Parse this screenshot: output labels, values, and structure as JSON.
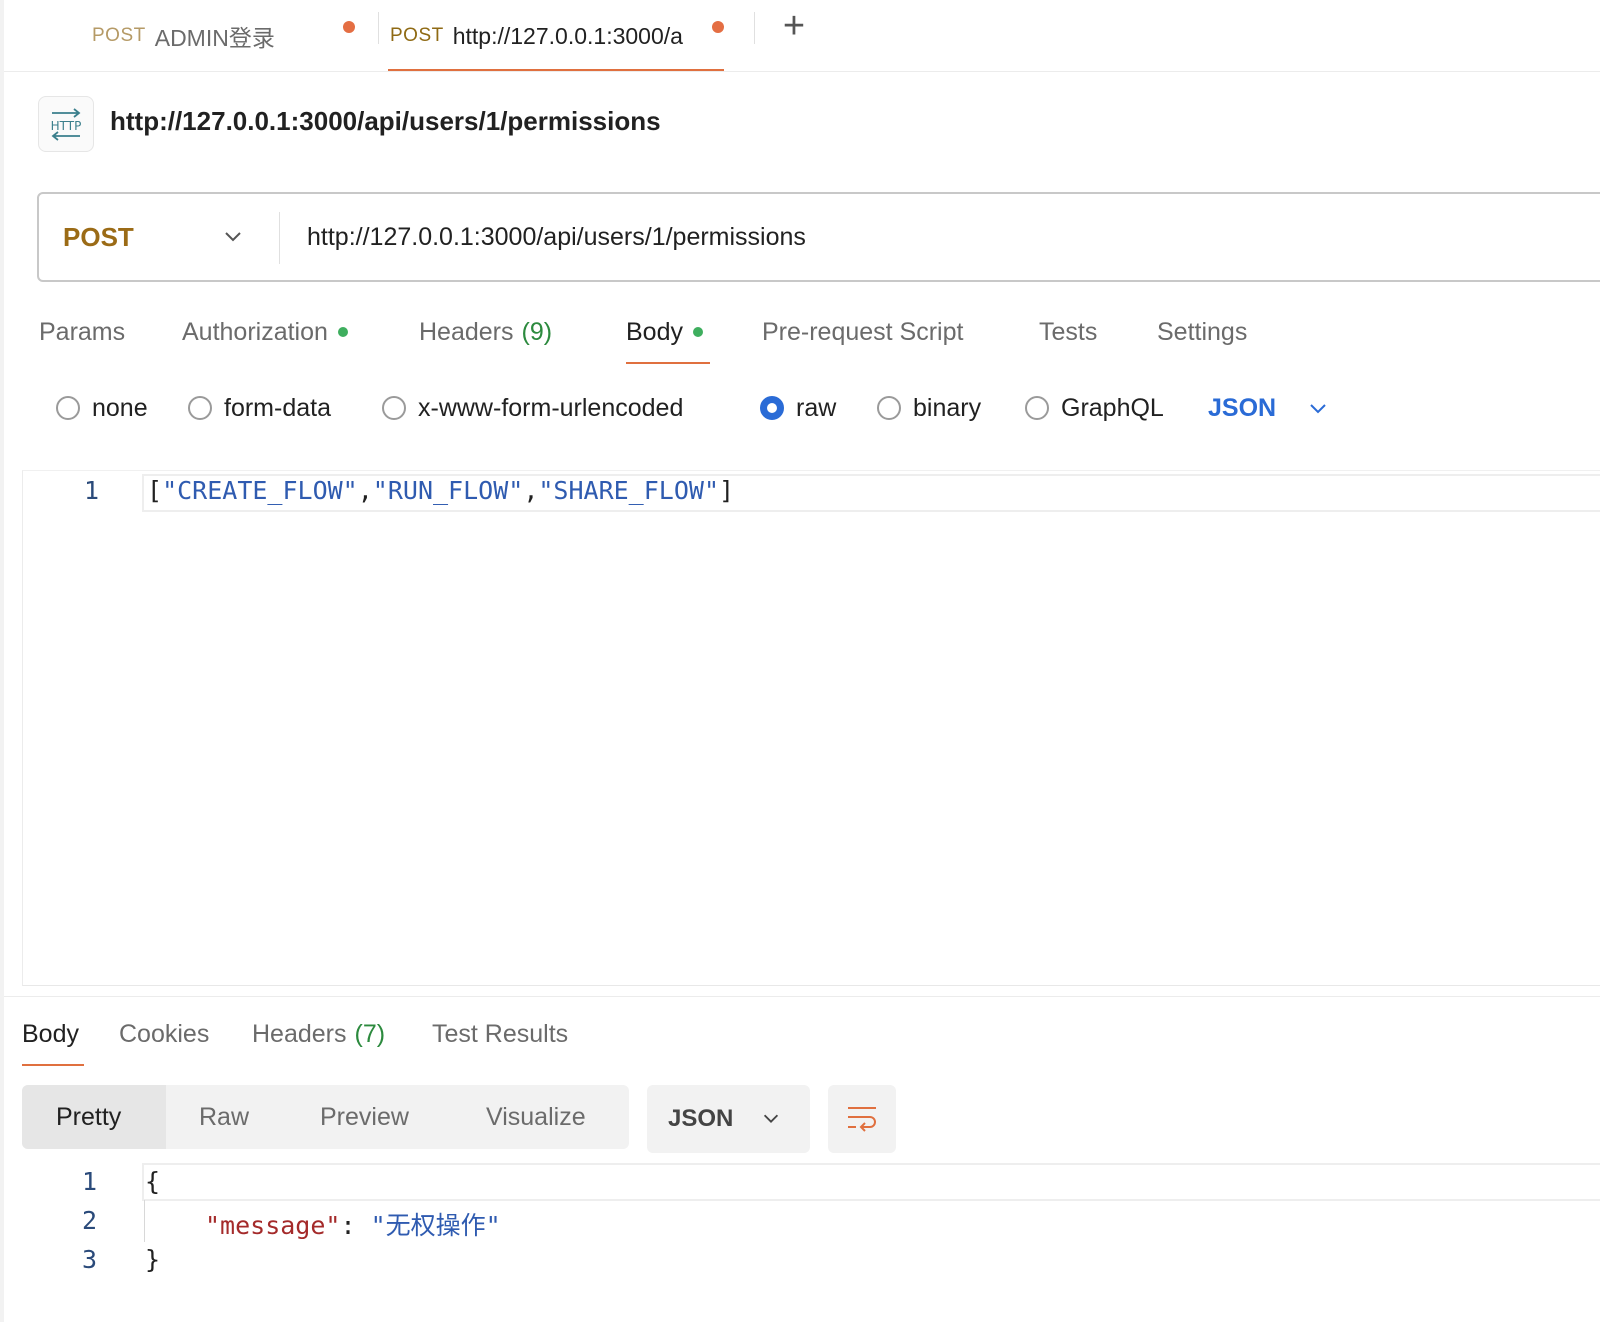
{
  "tabs": [
    {
      "method": "POST",
      "title": "ADMIN登录",
      "unsaved": true
    },
    {
      "method": "POST",
      "title": "http://127.0.0.1:3000/a",
      "unsaved": true,
      "active": true
    }
  ],
  "new_tab_label": "+",
  "request": {
    "type_badge": "HTTP",
    "title": "http://127.0.0.1:3000/api/users/1/permissions",
    "method": "POST",
    "url": "http://127.0.0.1:3000/api/users/1/permissions"
  },
  "request_tabs": {
    "params": "Params",
    "authorization": "Authorization",
    "headers": "Headers",
    "headers_count": "(9)",
    "body": "Body",
    "pre_request": "Pre-request Script",
    "tests": "Tests",
    "settings": "Settings",
    "active": "Body"
  },
  "body_modes": {
    "options": [
      "none",
      "form-data",
      "x-www-form-urlencoded",
      "raw",
      "binary",
      "GraphQL"
    ],
    "selected": "raw",
    "language": "JSON"
  },
  "request_body": {
    "line_numbers": [
      "1"
    ],
    "tokens": [
      "[",
      "\"CREATE_FLOW\"",
      ",",
      "\"RUN_FLOW\"",
      ",",
      "\"SHARE_FLOW\"",
      "]"
    ]
  },
  "response_tabs": {
    "body": "Body",
    "cookies": "Cookies",
    "headers": "Headers",
    "headers_count": "(7)",
    "test_results": "Test Results",
    "active": "Body"
  },
  "response_view": {
    "modes": [
      "Pretty",
      "Raw",
      "Preview",
      "Visualize"
    ],
    "selected": "Pretty",
    "format": "JSON"
  },
  "response_body": {
    "line_numbers": [
      "1",
      "2",
      "3"
    ],
    "open_brace": "{",
    "key": "\"message\"",
    "colon": ":",
    "value": "\"无权操作\"",
    "close_brace": "}"
  },
  "colors": {
    "accent_orange": "#e0703f",
    "method_post": "#8f6a14",
    "link_blue": "#2a6bd6",
    "status_green": "#3eae5e",
    "string_blue": "#2f5bb0",
    "key_red": "#a42a2a"
  }
}
